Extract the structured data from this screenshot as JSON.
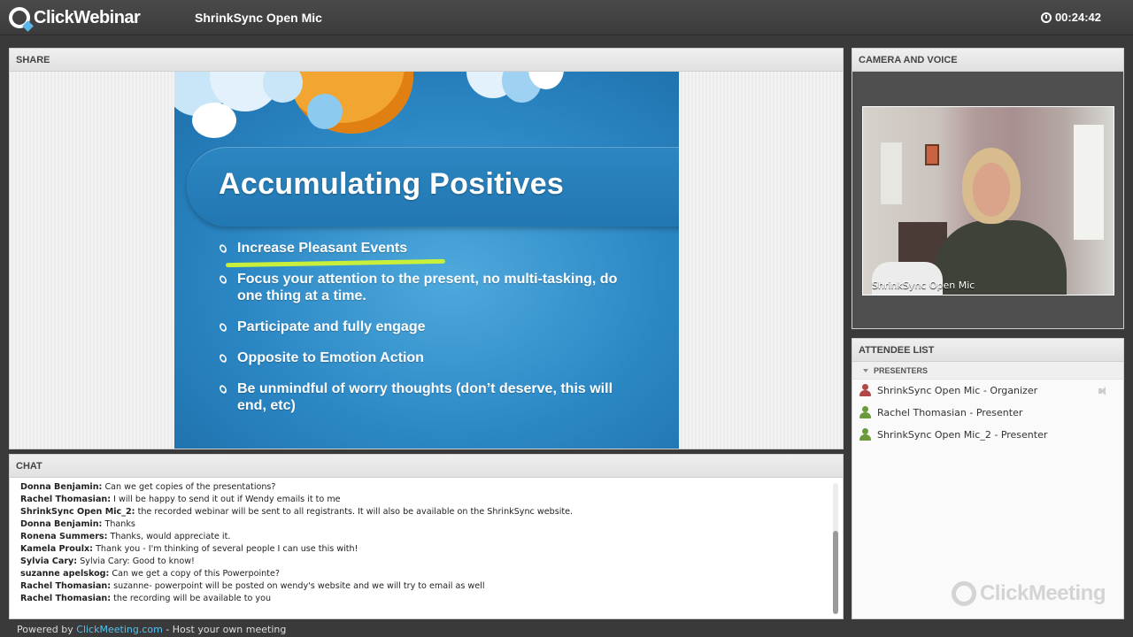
{
  "app": {
    "logo_text": "ClickWebinar",
    "session_title": "ShrinkSync Open Mic",
    "timer": "00:24:42"
  },
  "share": {
    "header": "SHARE",
    "slide": {
      "title": "Accumulating Positives",
      "bullets": [
        "Increase Pleasant Events",
        "Focus your attention to the present, no multi-tasking, do one thing at a time.",
        "Participate and fully engage",
        "Opposite to Emotion Action",
        "Be unmindful of worry thoughts (don’t deserve, this will end, etc)"
      ]
    }
  },
  "camera": {
    "header": "CAMERA AND VOICE",
    "video_label": "ShrinkSync Open Mic"
  },
  "attendees": {
    "header": "ATTENDEE LIST",
    "group_label": "PRESENTERS",
    "items": [
      {
        "label": "ShrinkSync Open Mic - Organizer",
        "color": "#b04848"
      },
      {
        "label": "Rachel Thomasian - Presenter",
        "color": "#6a9a3a"
      },
      {
        "label": "ShrinkSync Open Mic_2 - Presenter",
        "color": "#6a9a3a"
      }
    ],
    "watermark": "ClickMeeting"
  },
  "chat": {
    "header": "CHAT",
    "messages": [
      {
        "sender": "Donna Benjamin:",
        "text": " Can we get copies of the presentations?"
      },
      {
        "sender": "Rachel Thomasian:",
        "text": " I will be happy to send it out if Wendy emails it to me"
      },
      {
        "sender": "ShrinkSync Open Mic_2:",
        "text": " the recorded webinar will be sent to all registrants. It will also be available on the ShrinkSync website."
      },
      {
        "sender": "Donna Benjamin:",
        "text": " Thanks"
      },
      {
        "sender": "Ronena Summers:",
        "text": " Thanks, would appreciate it."
      },
      {
        "sender": "Kamela Proulx:",
        "text": " Thank you - I'm thinking of several people I can use this with!"
      },
      {
        "sender": "Sylvia Cary:",
        "text": " Sylvia Cary: Good to know!"
      },
      {
        "sender": "suzanne apelskog:",
        "text": " Can we get a copy of this Powerpointe?"
      },
      {
        "sender": "Rachel Thomasian:",
        "text": " suzanne- powerpoint will be posted on wendy's website and we will try to email as well"
      },
      {
        "sender": "Rachel Thomasian:",
        "text": " the recording will be available to you"
      }
    ]
  },
  "footer": {
    "prefix": "Powered by ",
    "link": "ClickMeeting.com",
    "suffix": " - Host your own meeting"
  }
}
